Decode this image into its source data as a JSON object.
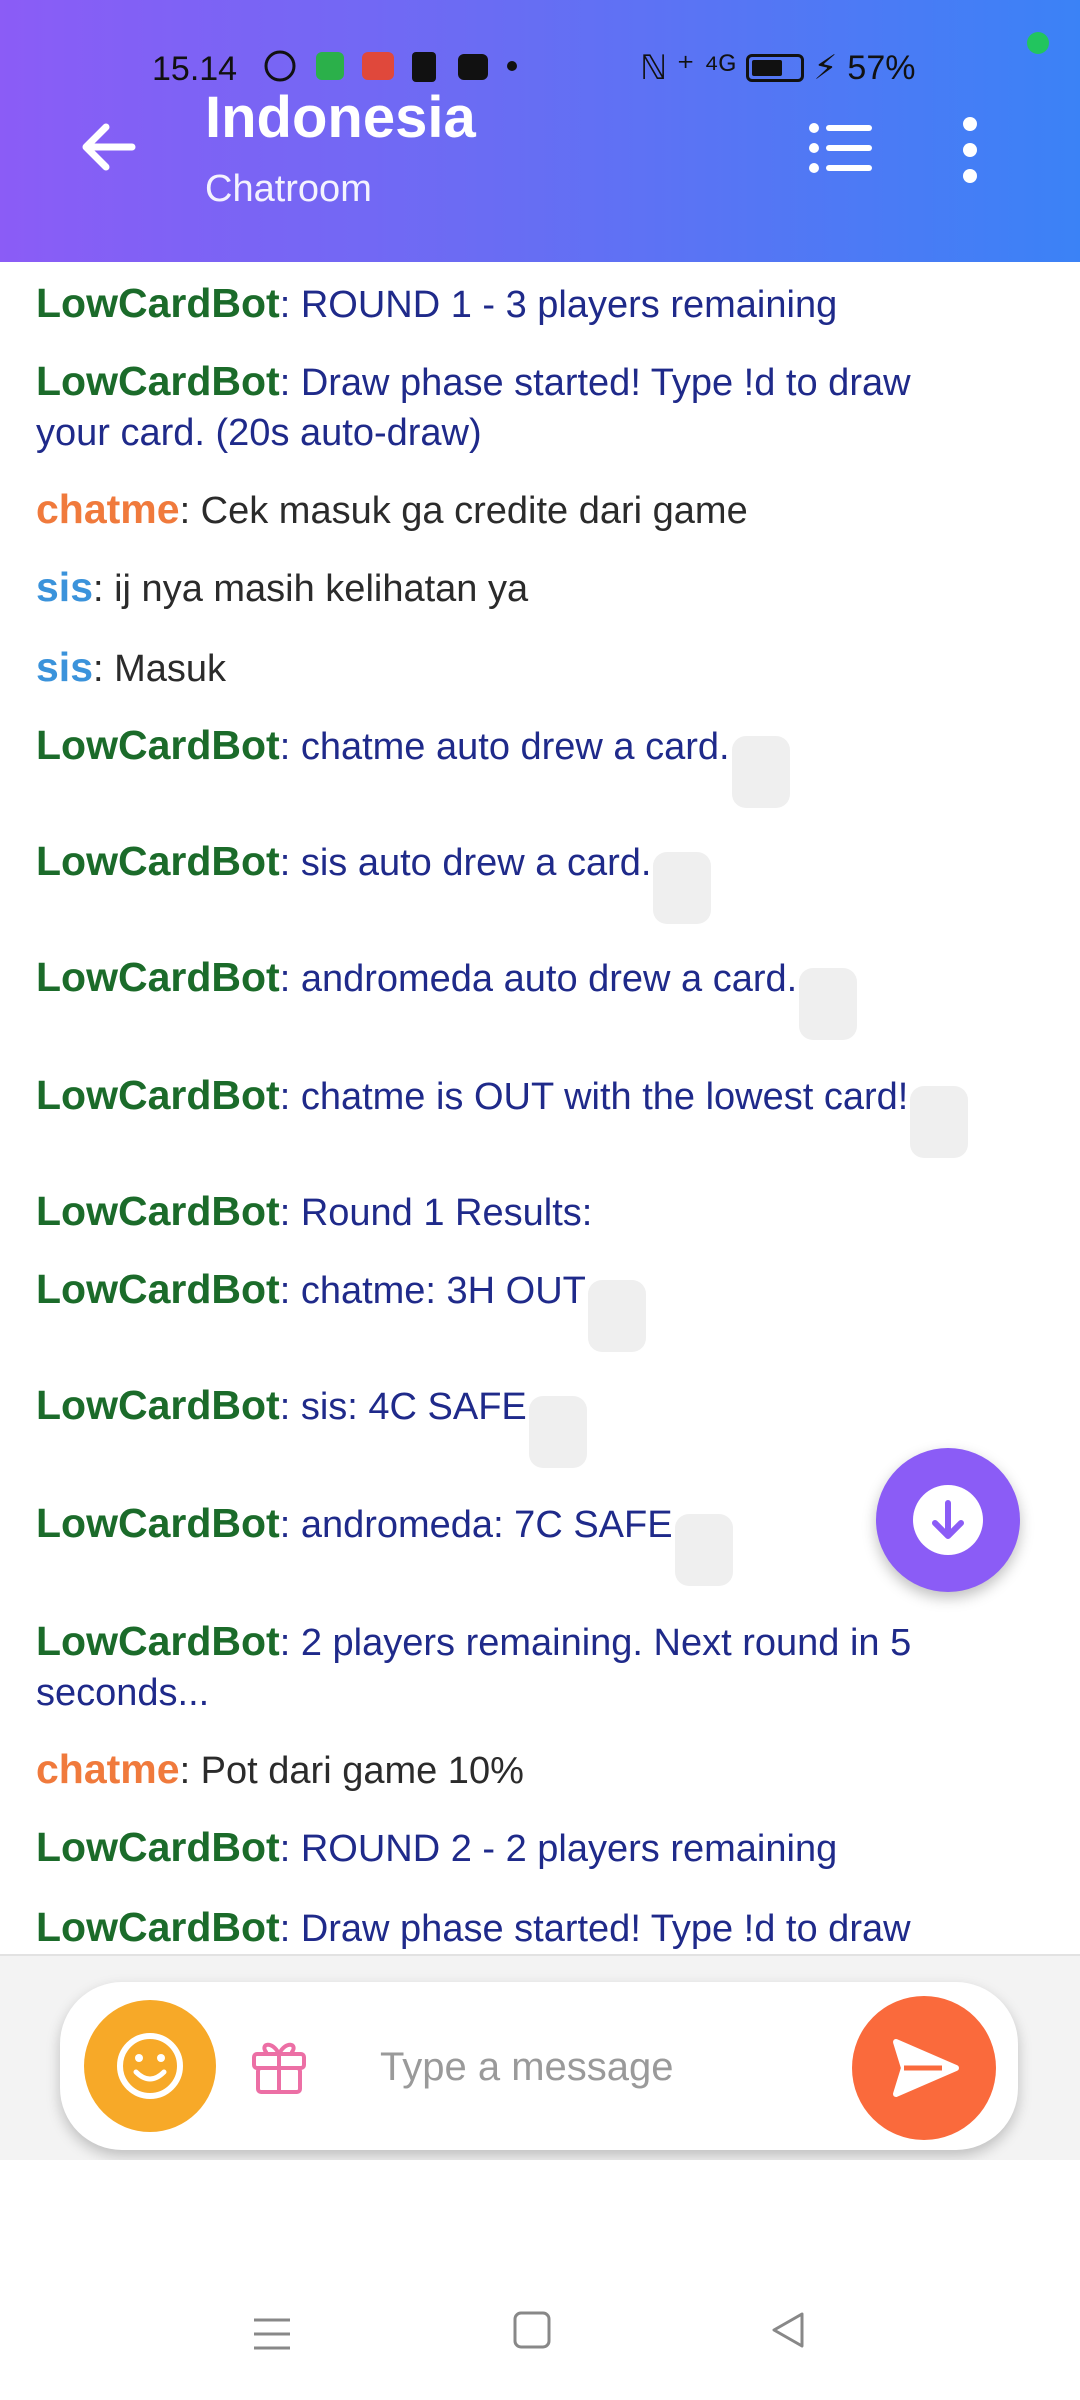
{
  "status_bar": {
    "time": "15.14",
    "icons": [
      "whatsapp-icon",
      "app-icon",
      "game-icon",
      "tiktok-icon",
      "app-icon",
      "dot-icon"
    ],
    "signal": "ℕ ⁺ ⁴ᴳ",
    "battery": "57%"
  },
  "header": {
    "title": "Indonesia",
    "subtitle": "Chatroom",
    "gradient": [
      "#8b5cf6",
      "#3b82f6"
    ]
  },
  "messages": [
    {
      "sender": "LowCardBot",
      "role": "bot",
      "text": ": ROUND 1 - 3 players remaining",
      "card": false
    },
    {
      "sender": "LowCardBot",
      "role": "bot",
      "text": ": Draw phase started! Type !d to draw your card. (20s auto-draw)",
      "card": false
    },
    {
      "sender": "chatme",
      "role": "chatme",
      "text": ": Cek masuk ga credite dari game",
      "card": false
    },
    {
      "sender": "sis",
      "role": "sis",
      "text": ": ij nya masih kelihatan ya",
      "card": false
    },
    {
      "sender": "sis",
      "role": "sis",
      "text": ": Masuk",
      "card": false
    },
    {
      "sender": "LowCardBot",
      "role": "bot",
      "text": ": chatme auto drew a card.",
      "card": true
    },
    {
      "sender": "LowCardBot",
      "role": "bot",
      "text": ": sis auto drew a card.",
      "card": true
    },
    {
      "sender": "LowCardBot",
      "role": "bot",
      "text": ": andromeda auto drew a card.",
      "card": true
    },
    {
      "sender": "LowCardBot",
      "role": "bot",
      "text": ": chatme is OUT with the lowest card!",
      "card": true
    },
    {
      "sender": "LowCardBot",
      "role": "bot",
      "text": ": Round 1 Results:",
      "card": false
    },
    {
      "sender": "LowCardBot",
      "role": "bot",
      "text": ": chatme: 3H OUT",
      "card": true
    },
    {
      "sender": "LowCardBot",
      "role": "bot",
      "text": ": sis: 4C SAFE",
      "card": true
    },
    {
      "sender": "LowCardBot",
      "role": "bot",
      "text": ": andromeda: 7C SAFE",
      "card": true
    },
    {
      "sender": "LowCardBot",
      "role": "bot",
      "text": ": 2 players remaining. Next round in 5 seconds...",
      "card": false
    },
    {
      "sender": "chatme",
      "role": "chatme",
      "text": ": Pot dari game 10%",
      "card": false
    },
    {
      "sender": "LowCardBot",
      "role": "bot",
      "text": ": ROUND 2 - 2 players remaining",
      "card": false
    },
    {
      "sender": "LowCardBot",
      "role": "bot",
      "text": ": Draw phase started! Type !d to draw",
      "card": false
    }
  ],
  "composer": {
    "placeholder": "Type a message",
    "emoji_color": "#f7a928",
    "send_color": "#fa6a3c"
  },
  "colors": {
    "bot_name": "#1b6b2a",
    "chatme_name": "#f07a3c",
    "sis_name": "#3b93db",
    "bot_text": "#1f2a8a",
    "scroll_button": "#8b5cf6"
  }
}
